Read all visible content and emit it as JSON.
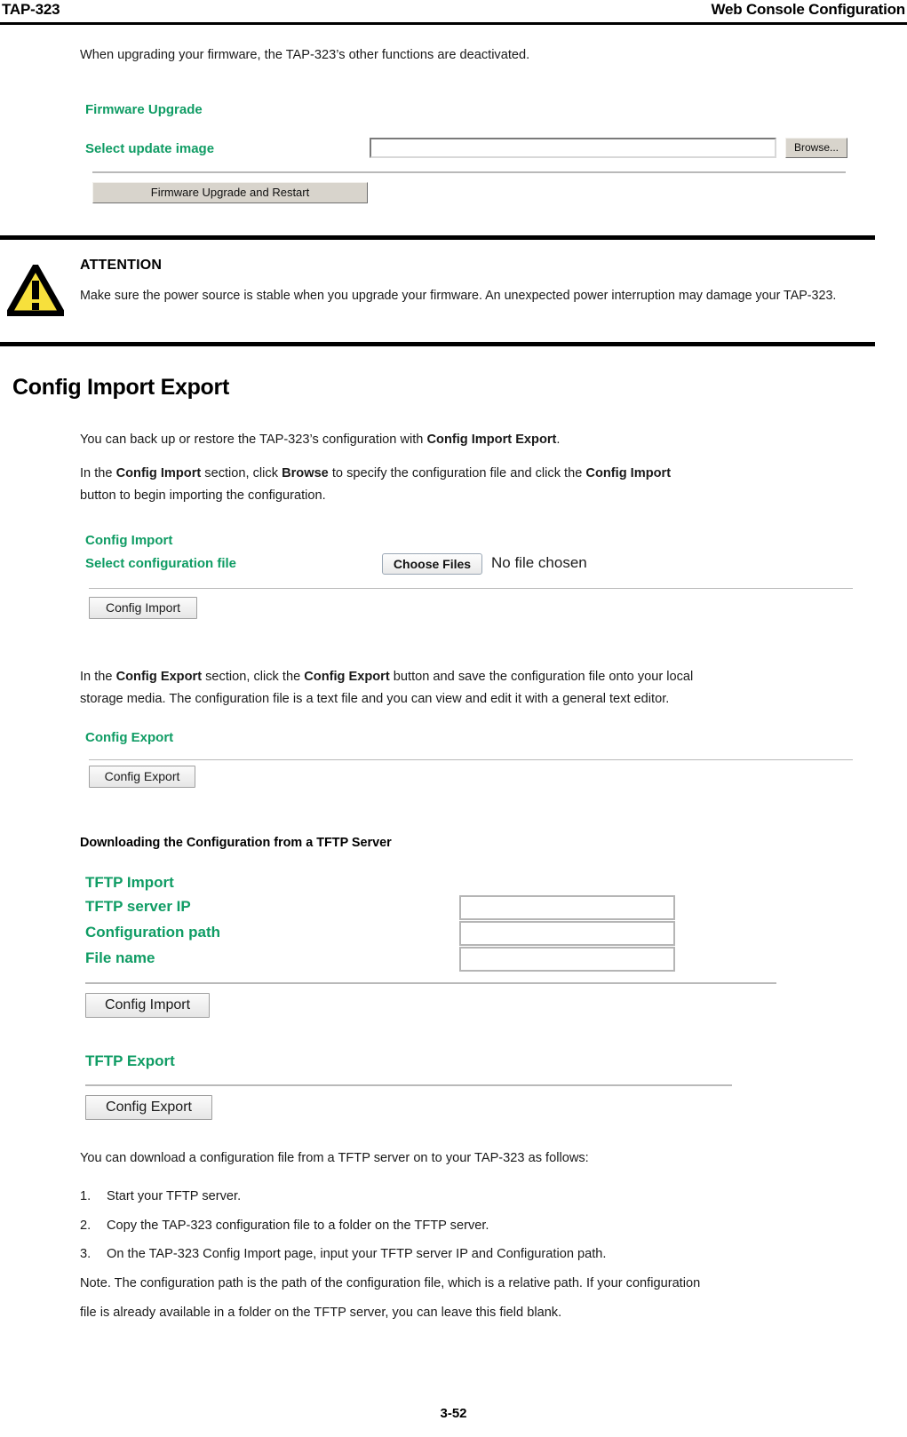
{
  "header": {
    "left": "TAP-323",
    "right": "Web Console Configuration"
  },
  "intro_paragraph": "When upgrading your firmware, the TAP-323’s other functions are deactivated.",
  "firmware_upgrade_panel": {
    "title": "Firmware Upgrade",
    "field_label": "Select update image",
    "input_value": "",
    "browse_button": "Browse...",
    "submit_button": "Firmware Upgrade and Restart"
  },
  "attention": {
    "icon": "warning-triangle-icon",
    "title": "ATTENTION",
    "body": "Make sure the power source is stable when you upgrade your firmware. An unexpected power interruption may damage your TAP-323."
  },
  "section": {
    "heading": "Config Import Export",
    "paragraph_1_a": "You can back up or restore the TAP-323’s configuration with ",
    "paragraph_1_b": "Config Import Export",
    "paragraph_1_c": ".",
    "paragraph_2_a": "In the ",
    "paragraph_2_b": "Config Import",
    "paragraph_2_c": " section, click ",
    "paragraph_2_d": "Browse",
    "paragraph_2_e": " to specify the configuration file and click the ",
    "paragraph_2_f": "Config Import",
    "paragraph_2_g": "button to begin importing the configuration.",
    "paragraph_3_a": "In the ",
    "paragraph_3_b": "Config Export",
    "paragraph_3_c": " section, click the ",
    "paragraph_3_d": "Config Export",
    "paragraph_3_e": " button and save the configuration file onto your local",
    "paragraph_3_f": "storage media. The configuration file is a text file and you can view and edit it with a general text editor."
  },
  "config_import_panel": {
    "title": "Config Import",
    "field_label": "Select configuration file",
    "choose_button": "Choose Files",
    "file_status": "No file chosen",
    "submit_button": "Config Import"
  },
  "config_export_panel": {
    "title": "Config Export",
    "submit_button": "Config Export"
  },
  "tftp_heading": "Downloading the Configuration from a TFTP Server",
  "tftp_import_panel": {
    "title": "TFTP Import",
    "fields": [
      {
        "label": "TFTP server IP",
        "value": ""
      },
      {
        "label": "Configuration path",
        "value": ""
      },
      {
        "label": "File name",
        "value": ""
      }
    ],
    "submit_button": "Config Import"
  },
  "tftp_export_panel": {
    "title": "TFTP Export",
    "submit_button": "Config Export"
  },
  "download_intro": "You can download a configuration file from a TFTP server on to your TAP-323 as follows:",
  "steps": [
    {
      "index": "1.",
      "text": "Start your TFTP server."
    },
    {
      "index": "2.",
      "text": "Copy the TAP-323 configuration file to a folder on the TFTP server."
    },
    {
      "index": "3.",
      "text": "On the TAP-323 Config Import page, input your TFTP server IP and Configuration path."
    }
  ],
  "note_line_1": "Note. The configuration path is the path of the configuration file, which is a relative path. If your configuration",
  "note_line_2": "file is already available in a folder on the TFTP server, you can leave this field blank.",
  "footer": {
    "page_number": "3-52"
  },
  "colors": {
    "ui_label_green": "#0f9c64",
    "warning_yellow": "#f7e03c",
    "rule_gray": "#b9b9b9"
  }
}
